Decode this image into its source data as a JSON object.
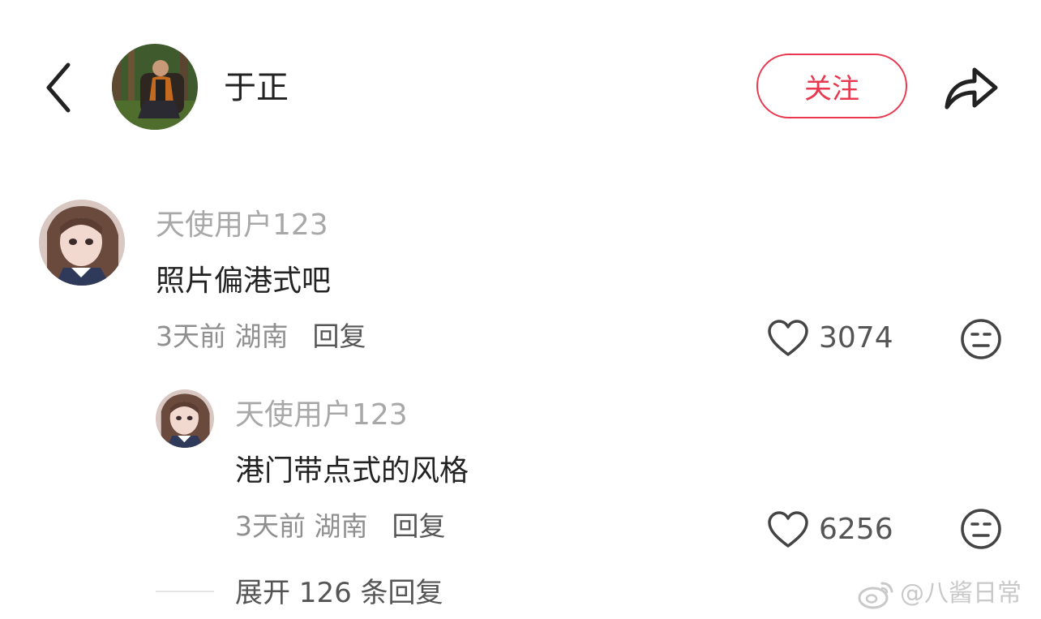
{
  "header": {
    "author_name": "于正",
    "follow_label": "关注"
  },
  "comments": [
    {
      "username": "天使用户123",
      "text": "照片偏港式吧",
      "meta": "3天前 湖南",
      "reply_label": "回复",
      "likes": "3074"
    },
    {
      "username": "天使用户123",
      "text": "港门带点式的风格",
      "meta": "3天前 湖南",
      "reply_label": "回复",
      "likes": "6256"
    }
  ],
  "expand_label": "展开 126 条回复",
  "watermark": {
    "text": "@八酱日常",
    "icon": "weibo-icon"
  },
  "colors": {
    "accent": "#e8384f",
    "username_gray": "#a8a8a8",
    "meta_gray": "#8f8f8f"
  },
  "icons": [
    "back-arrow-icon",
    "share-icon",
    "heart-icon",
    "dislike-face-icon"
  ]
}
